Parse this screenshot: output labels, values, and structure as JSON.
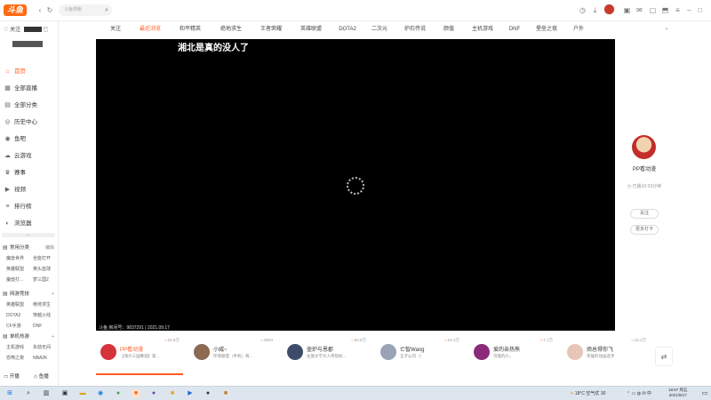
{
  "app": {
    "logo_text": "斗鱼",
    "accent": "#ff5d23"
  },
  "topbar": {
    "search_placeholder": "斗鱼搜索",
    "back_icon": "‹",
    "forward_icon": "›",
    "refresh_icon": "↻",
    "search_icon": "⌕",
    "right_icons": [
      "clock-icon",
      "download-icon",
      "avatar",
      "gift-icon",
      "mail-icon",
      "bag-icon",
      "skin-icon",
      "menu-icon",
      "minimize-icon",
      "maximize-icon",
      "close-icon"
    ]
  },
  "sidebar": {
    "follow_label": "关注",
    "follow_badge": "已",
    "username": "",
    "nav": [
      {
        "icon": "⌂",
        "label": "首页",
        "active": true
      },
      {
        "icon": "▦",
        "label": "全部直播",
        "active": false
      },
      {
        "icon": "▤",
        "label": "全部分类",
        "active": false
      },
      {
        "icon": "◎",
        "label": "历史中心",
        "active": false
      },
      {
        "icon": "◉",
        "label": "鱼吧",
        "active": false
      },
      {
        "icon": "☁",
        "label": "云游戏",
        "active": false
      },
      {
        "icon": "♛",
        "label": "赛事",
        "active": false
      },
      {
        "icon": "▶",
        "label": "视频",
        "active": false
      },
      {
        "icon": "≡",
        "label": "排行榜",
        "active": false
      },
      {
        "icon": "◐",
        "label": "浏览器",
        "active": false
      }
    ],
    "collapse_icon": "︿",
    "sections": [
      {
        "title": "常用分类",
        "action": "编辑",
        "items": [
          "魔兽世界",
          "全能打开",
          "英雄联盟",
          "英头蓝球",
          "魔兽打...",
          "梦三国2"
        ]
      },
      {
        "title": "网游竞技",
        "action": "+",
        "items": [
          "英雄联盟",
          "绝地求生",
          "DOTA2",
          "穿越火线",
          "CF手游",
          "DNF"
        ]
      },
      {
        "title": "单机热游",
        "action": "+",
        "items": [
          "主机游戏",
          "永劫无间",
          "恐怖之夜",
          "NBA2K"
        ]
      }
    ],
    "footer_left": "开播",
    "footer_right": "鱼播"
  },
  "categories": [
    "关注",
    "最近浏览",
    "和平精英",
    "绝地求生",
    "王者荣耀",
    "英雄联盟",
    "DOTA2",
    "二次元",
    "炉石传说",
    "颜值",
    "主机游戏",
    "DNF",
    "堡垒之夜",
    "户外"
  ],
  "category_more_icon": "›",
  "player": {
    "danmu": "湘北是真的没人了",
    "room_line": "斗鱼 房间号：9837291 | 2021.09.17"
  },
  "anchor": {
    "name": "PP看动漫",
    "info": "已播10:03分钟",
    "follow_btn": "关注",
    "share_btn": "更多打卡"
  },
  "recommend": [
    {
      "name": "PP看动漫",
      "title": "【海大三国赛道】第...",
      "hot": "24.8万",
      "color": "#d4343a",
      "active": true
    },
    {
      "name": "小威~",
      "title": "环境联盟（手机）每...",
      "hot": "2604",
      "color": "#8a6a52",
      "active": false
    },
    {
      "name": "壶炉与恩郡",
      "title": "左旅大学大人突现如...",
      "hot": "60.8万",
      "color": "#3e4c6b",
      "active": false
    },
    {
      "name": "亡智Wang",
      "title": "王子公司（）",
      "hot": "24.2万",
      "color": "#9aa3b5",
      "active": false
    },
    {
      "name": "爱的亲热熊",
      "title": "可能的小，",
      "hot": "7.1万",
      "color": "#8a2a7a",
      "active": false
    },
    {
      "name": "烦总得你飞",
      "title": "英雄的动画选手",
      "hot": "10.1万",
      "color": "#e7c5b7",
      "active": false
    }
  ],
  "recommend_hot_icon": "🔥",
  "refresh_icon": "⇄",
  "taskbar": {
    "start_icon": "⊞",
    "weather": "18°C 空气优 30",
    "time": "18:57 周五",
    "date": "2021/9/17"
  }
}
